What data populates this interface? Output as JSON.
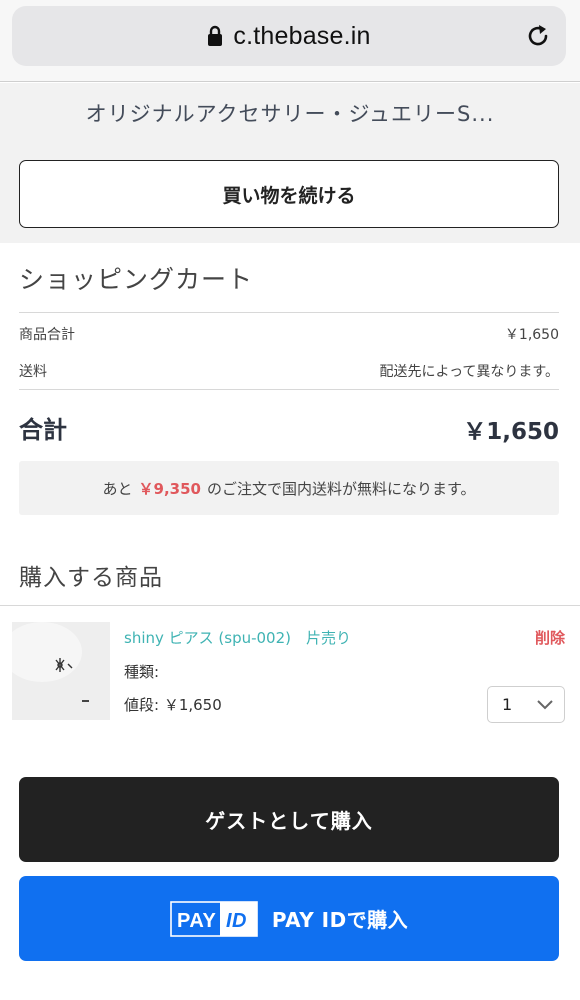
{
  "browser": {
    "url": "c.thebase.in",
    "lock_icon": "lock-icon",
    "reload_icon": "reload-icon"
  },
  "shop": {
    "name": "オリジナルアクセサリー・ジュエリーS...",
    "continue_label": "買い物を続ける"
  },
  "cart": {
    "title": "ショッピングカート",
    "subtotal_label": "商品合計",
    "subtotal_value": "￥1,650",
    "shipping_label": "送料",
    "shipping_value": "配送先によって異なります。",
    "total_label": "合計",
    "total_value": "￥1,650",
    "notice_prefix": "あと",
    "notice_amount": "￥9,350",
    "notice_suffix": "のご注文で国内送料が無料になります。",
    "notice_amount_color": "#e0585c"
  },
  "items_section": {
    "title": "購入する商品",
    "items": [
      {
        "name": "shiny ピアス (spu-002)　片売り",
        "kind_label": "種類:",
        "price_label": "値段: ￥1,650",
        "quantity": "1",
        "delete_label": "削除",
        "name_color": "#3fb3b3"
      }
    ]
  },
  "purchase": {
    "guest_label": "ゲストとして購入",
    "payid_logo_text": "PAY",
    "payid_logo_id": "ID",
    "payid_label": "PAY IDで購入",
    "payid_color": "#1070f0",
    "guest_color": "#222222"
  }
}
